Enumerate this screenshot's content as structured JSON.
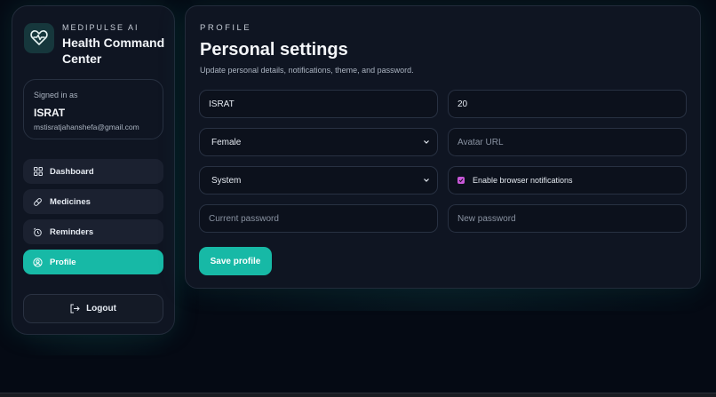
{
  "brand": {
    "eyebrow": "MEDIPULSE AI",
    "title": "Health Command Center",
    "logo_icon": "heart-pulse-icon"
  },
  "account": {
    "label": "Signed in as",
    "name": "ISRAT",
    "email": "mstisratjahanshefa@gmail.com"
  },
  "nav": {
    "items": [
      {
        "label": "Dashboard",
        "icon": "grid-icon",
        "active": false
      },
      {
        "label": "Medicines",
        "icon": "pill-icon",
        "active": false
      },
      {
        "label": "Reminders",
        "icon": "alarm-icon",
        "active": false
      },
      {
        "label": "Profile",
        "icon": "user-circle-icon",
        "active": true
      }
    ],
    "logout_label": "Logout"
  },
  "profile": {
    "eyebrow": "PROFILE",
    "title": "Personal settings",
    "subtitle": "Update personal details, notifications, theme, and password.",
    "name_value": "ISRAT",
    "age_value": "20",
    "gender_value": "Female",
    "avatar_placeholder": "Avatar URL",
    "theme_value": "System",
    "notifications_label": "Enable browser notifications",
    "notifications_checked": true,
    "current_password_placeholder": "Current password",
    "new_password_placeholder": "New password",
    "save_label": "Save profile"
  },
  "colors": {
    "accent": "#17b9a6",
    "background": "#050a14",
    "card": "#0f1522",
    "checkbox": "#c858d8"
  }
}
